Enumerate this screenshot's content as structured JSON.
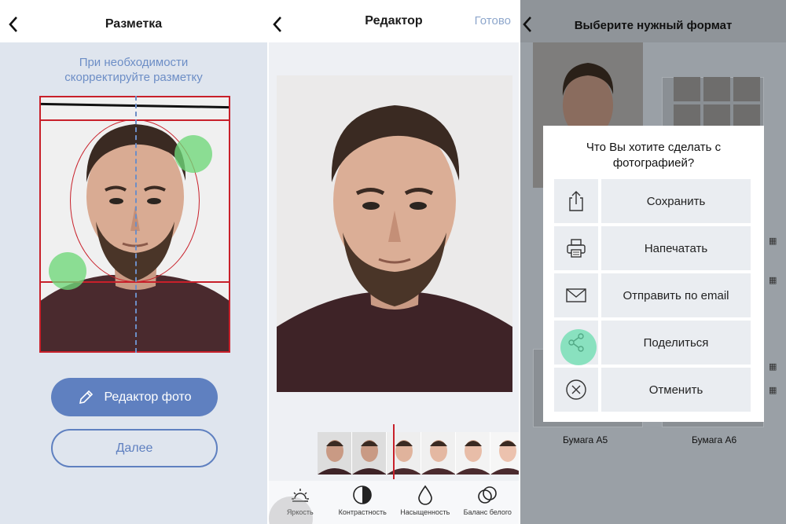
{
  "panel1": {
    "title": "Разметка",
    "hint_line1": "При необходимости",
    "hint_line2": "скорректируйте разметку",
    "photo_editor_button": "Редактор фото",
    "next_button": "Далее",
    "icons": {
      "back": "chevron-left-icon",
      "edit": "pencil-icon"
    }
  },
  "panel2": {
    "title": "Редактор",
    "done_button": "Готово",
    "tools": [
      {
        "label": "Яркость",
        "icon": "sun-icon"
      },
      {
        "label": "Контрастность",
        "icon": "contrast-icon"
      },
      {
        "label": "Насыщенность",
        "icon": "drop-icon"
      },
      {
        "label": "Баланс белого",
        "icon": "rings-icon"
      }
    ]
  },
  "panel3": {
    "title": "Выберите нужный формат",
    "dialog_question_line1": "Что Вы хотите сделать с",
    "dialog_question_line2": "фотографией?",
    "actions": [
      {
        "label": "Сохранить",
        "icon": "share-upload-icon"
      },
      {
        "label": "Напечатать",
        "icon": "printer-icon"
      },
      {
        "label": "Отправить по email",
        "icon": "envelope-icon"
      },
      {
        "label": "Поделиться",
        "icon": "share-icon"
      },
      {
        "label": "Отменить",
        "icon": "cancel-icon"
      }
    ],
    "paper_a5": "Бумага A5",
    "paper_a6": "Бумага A6"
  },
  "colors": {
    "accent_blue": "#5f80c0",
    "guide_red": "#c8202a",
    "handle_green": "#6ed778"
  }
}
